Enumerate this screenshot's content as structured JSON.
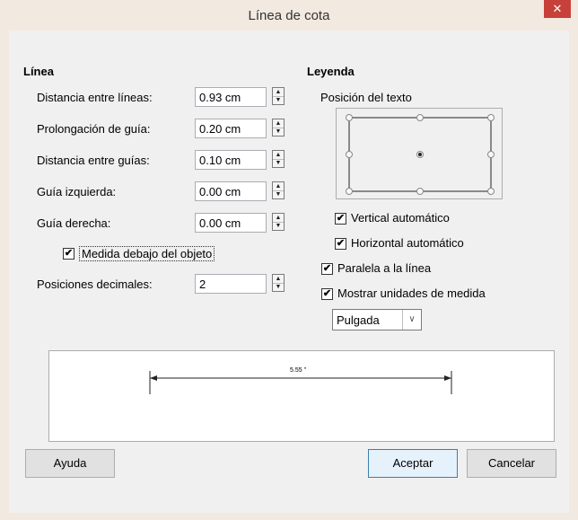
{
  "window": {
    "title": "Línea de cota",
    "close_glyph": "✕"
  },
  "linea": {
    "title": "Línea",
    "fields": [
      {
        "label": "Distancia entre líneas:",
        "value": "0.93 cm"
      },
      {
        "label": "Prolongación de guía:",
        "value": "0.20 cm"
      },
      {
        "label": "Distancia entre guías:",
        "value": "0.10 cm"
      },
      {
        "label": "Guía izquierda:",
        "value": "0.00 cm"
      },
      {
        "label": "Guía derecha:",
        "value": "0.00 cm"
      }
    ],
    "medida_checkbox": {
      "label": "Medida debajo del objeto",
      "checked": true
    },
    "decimales": {
      "label": "Posiciones decimales:",
      "value": "2"
    }
  },
  "leyenda": {
    "title": "Leyenda",
    "posicion_label": "Posición del texto",
    "vertical": {
      "label": "Vertical automático",
      "checked": true
    },
    "horizontal": {
      "label": "Horizontal automático",
      "checked": true
    },
    "paralela": {
      "label": "Paralela a la línea",
      "checked": true
    },
    "mostrar": {
      "label": "Mostrar unidades de medida",
      "checked": true
    },
    "unidad": {
      "value": "Pulgada"
    }
  },
  "preview": {
    "measure_text": "5.55 \""
  },
  "buttons": {
    "help": "Ayuda",
    "ok": "Aceptar",
    "cancel": "Cancelar"
  },
  "icons": {
    "spin_up": "▲",
    "spin_down": "▼",
    "check": "✔",
    "dropdown": "∨"
  }
}
